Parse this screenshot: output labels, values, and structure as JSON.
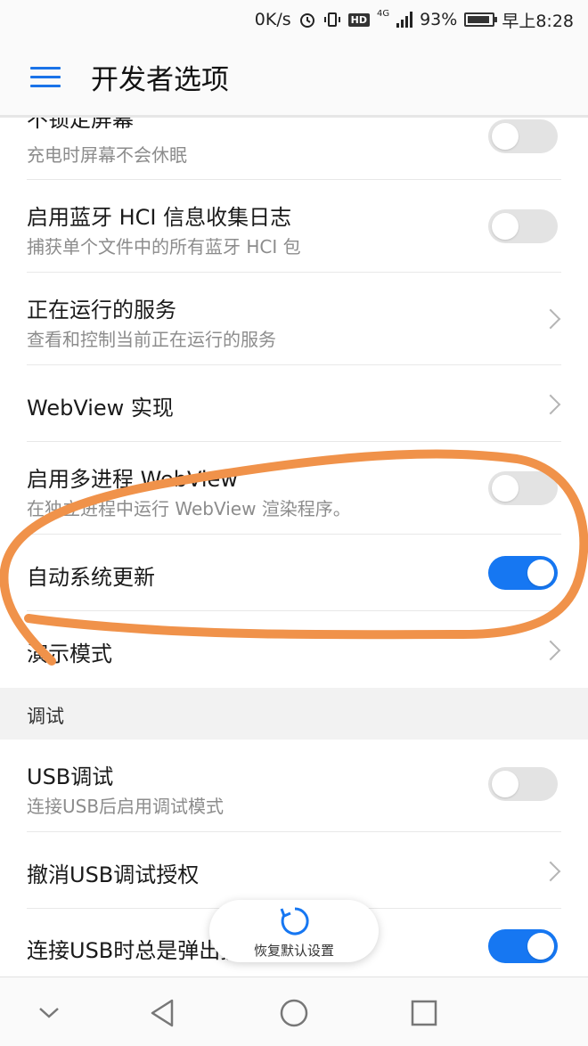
{
  "status_bar": {
    "speed": "0K/s",
    "hd": "HD",
    "network": "4G",
    "battery_percent": "93%",
    "battery_level": 0.93,
    "time": "早上8:28"
  },
  "header": {
    "title": "开发者选项"
  },
  "rows": [
    {
      "title": "不锁定屏幕",
      "subtitle": "充电时屏幕不会休眠",
      "control": "toggle",
      "on": false
    },
    {
      "title": "启用蓝牙 HCI 信息收集日志",
      "subtitle": "捕获单个文件中的所有蓝牙 HCI 包",
      "control": "toggle",
      "on": false
    },
    {
      "title": "正在运行的服务",
      "subtitle": "查看和控制当前正在运行的服务",
      "control": "chevron"
    },
    {
      "title": "WebView 实现",
      "control": "chevron"
    },
    {
      "title": "启用多进程 WebView",
      "subtitle": "在独立进程中运行 WebView 渲染程序。",
      "control": "toggle",
      "on": false
    },
    {
      "title": "自动系统更新",
      "control": "toggle",
      "on": true
    },
    {
      "title": "演示模式",
      "control": "chevron"
    }
  ],
  "section": {
    "title": "调试"
  },
  "debug_rows": [
    {
      "title": "USB调试",
      "subtitle": "连接USB后启用调试模式",
      "control": "toggle",
      "on": false
    },
    {
      "title": "撤消USB调试授权",
      "control": "chevron"
    },
    {
      "title": "连接USB时总是弹出提示",
      "control": "toggle",
      "on": true
    }
  ],
  "restore_button": {
    "label": "恢复默认设置"
  },
  "icons": {
    "menu": "menu-icon",
    "back": "back-triangle-icon",
    "home": "home-circle-icon",
    "recents": "recents-square-icon",
    "collapse": "chevron-down-icon",
    "restore": "refresh-icon"
  },
  "colors": {
    "accent": "#1677f2",
    "annotation": "#f0924a"
  }
}
